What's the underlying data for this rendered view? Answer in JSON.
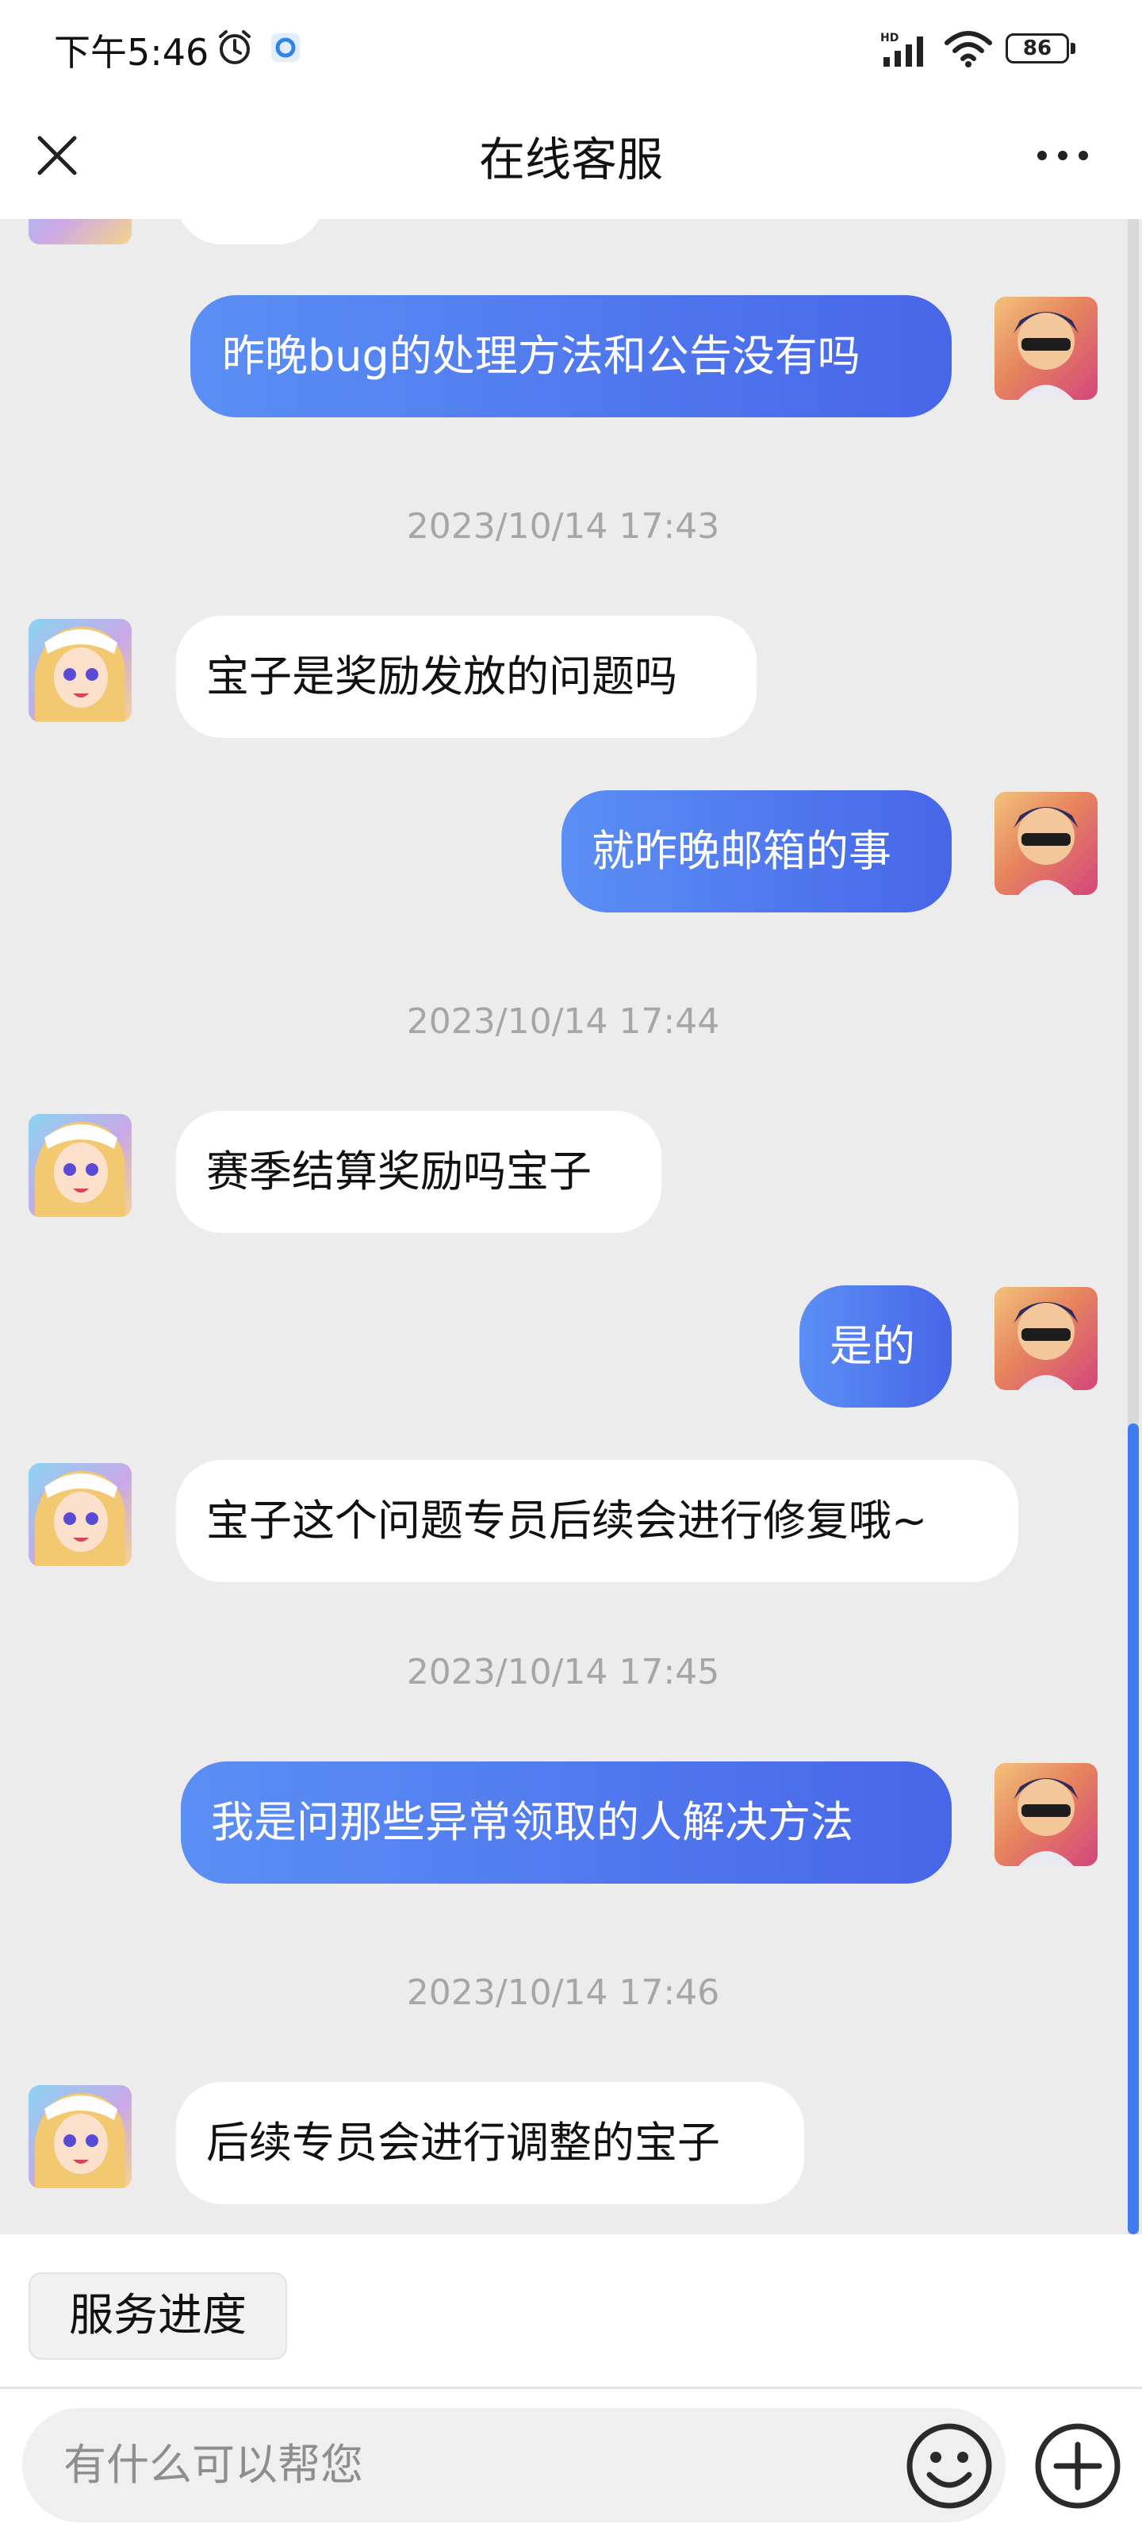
{
  "status_bar": {
    "time": "下午5:46",
    "battery": "86",
    "network_badge": "HD"
  },
  "header": {
    "title": "在线客服"
  },
  "messages": [
    {
      "side": "out",
      "text": "昨晚bug的处理方法和公告没有吗"
    },
    {
      "timestamp": "2023/10/14 17:43"
    },
    {
      "side": "in",
      "text": "宝子是奖励发放的问题吗"
    },
    {
      "side": "out",
      "text": "就昨晚邮箱的事"
    },
    {
      "timestamp": "2023/10/14 17:44"
    },
    {
      "side": "in",
      "text": "赛季结算奖励吗宝子"
    },
    {
      "side": "out",
      "text": "是的"
    },
    {
      "side": "in",
      "text": "宝子这个问题专员后续会进行修复哦~"
    },
    {
      "timestamp": "2023/10/14 17:45"
    },
    {
      "side": "out",
      "text": "我是问那些异常领取的人解决方法"
    },
    {
      "timestamp": "2023/10/14 17:46"
    },
    {
      "side": "in",
      "text": "后续专员会进行调整的宝子"
    }
  ],
  "quick_action": {
    "label": "服务进度"
  },
  "input": {
    "placeholder": "有什么可以帮您"
  },
  "icons": {
    "close": "close-icon",
    "more": "more-icon",
    "emoji": "emoji-icon",
    "plus": "plus-icon",
    "alarm": "alarm-icon",
    "signal": "signal-icon",
    "wifi": "wifi-icon"
  },
  "colors": {
    "outgoing_bubble_start": "#5b8ff5",
    "outgoing_bubble_end": "#4766e8",
    "scroll_thumb": "#3f7bf2"
  }
}
